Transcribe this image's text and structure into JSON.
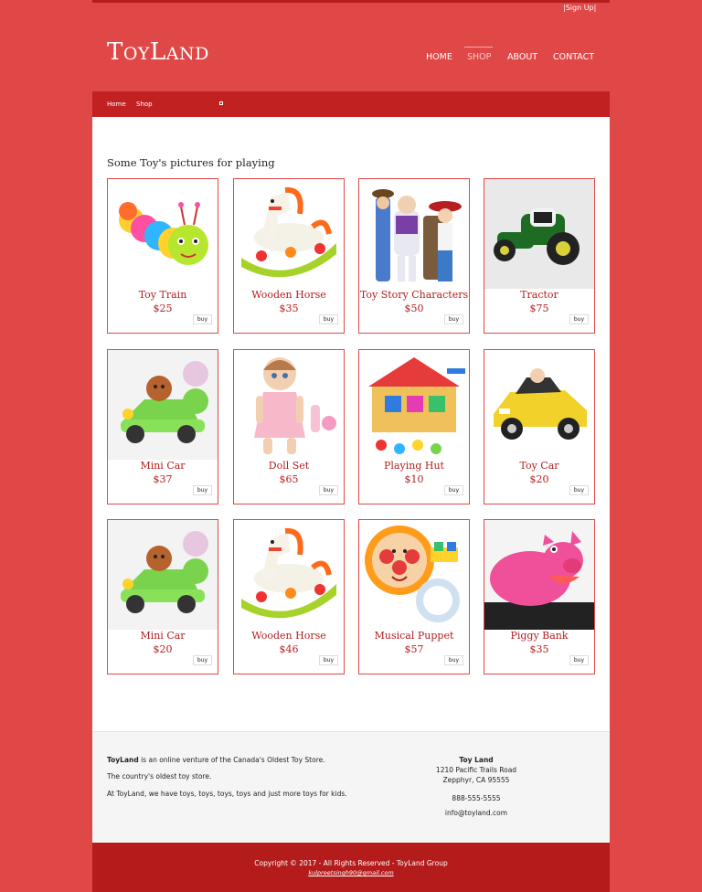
{
  "header": {
    "signup": "|Sign Up|",
    "logo_first": "T",
    "logo_rest1": "OY",
    "logo_second": "L",
    "logo_rest2": "AND",
    "nav": [
      "HOME",
      "SHOP",
      "ABOUT",
      "CONTACT"
    ],
    "active_nav": "SHOP"
  },
  "breadcrumb": [
    "Home",
    "Shop"
  ],
  "main": {
    "title": "Some Toy's pictures for playing",
    "buy_label": "buy",
    "products": [
      {
        "name": "Toy Train",
        "price": "$25",
        "icon": "caterpillar-toy"
      },
      {
        "name": "Wooden Horse",
        "price": "$35",
        "icon": "rocking-horse"
      },
      {
        "name": "Toy Story Characters",
        "price": "$50",
        "icon": "toy-story-group"
      },
      {
        "name": "Tractor",
        "price": "$75",
        "icon": "tractor"
      },
      {
        "name": "Mini Car",
        "price": "$37",
        "icon": "mini-car"
      },
      {
        "name": "Doll Set",
        "price": "$65",
        "icon": "doll"
      },
      {
        "name": "Playing Hut",
        "price": "$10",
        "icon": "playing-hut"
      },
      {
        "name": "Toy Car",
        "price": "$20",
        "icon": "toy-car"
      },
      {
        "name": "Mini Car",
        "price": "$20",
        "icon": "mini-car"
      },
      {
        "name": "Wooden Horse",
        "price": "$46",
        "icon": "rocking-horse"
      },
      {
        "name": "Musical Puppet",
        "price": "$57",
        "icon": "musical-puppet"
      },
      {
        "name": "Piggy Bank",
        "price": "$35",
        "icon": "piggy-bank"
      }
    ]
  },
  "footer": {
    "brand": "ToyLand",
    "line1_rest": " is an online venture of the Canada's Oldest Toy Store.",
    "line2": "The country's oldest toy store.",
    "line3": "At ToyLand, we have toys, toys, toys, toys and just more toys for kids.",
    "contact_name": "Toy Land",
    "address1": "1210 Pacific Trails Road",
    "address2": "Zepphyr, CA 95555",
    "phone": "888-555-5555",
    "email": "info@toyland.com",
    "copyright": "Copyright © 2017 - All Rights Reserved - ToyLand Group",
    "author_email": "kulpreetsingh90@gmail.com"
  },
  "colors": {
    "background": "#e04848",
    "accent": "#b21e1e",
    "dark": "#c22121"
  }
}
